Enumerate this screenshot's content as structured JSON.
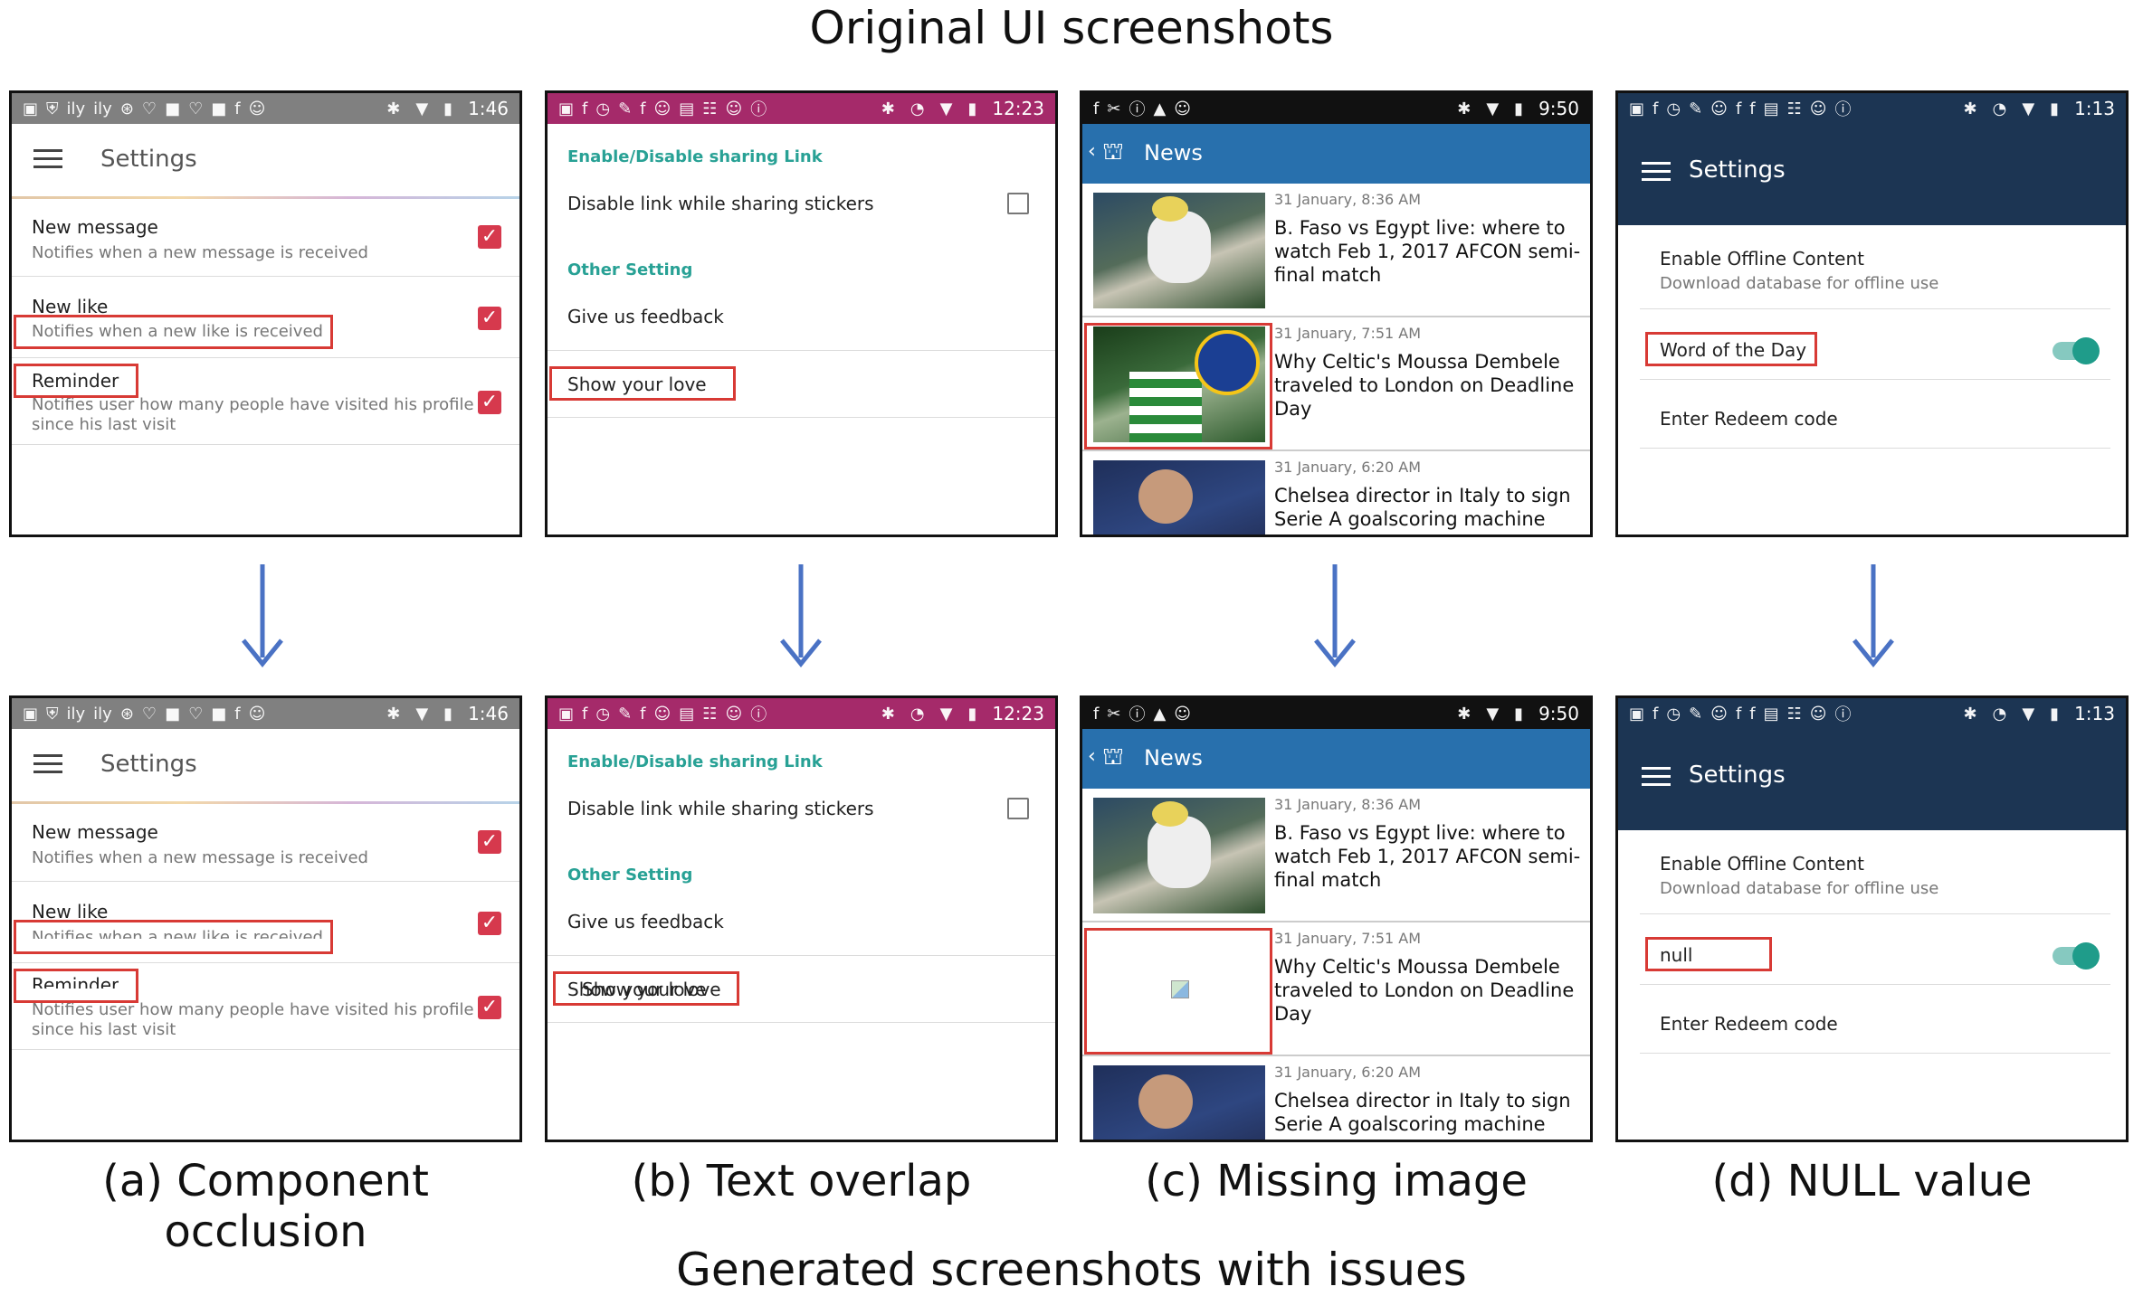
{
  "top_heading": "Original UI screenshots",
  "bottom_heading": "Generated screenshots with issues",
  "captions": [
    "(a) Component occlusion",
    "(b) Text overlap",
    "(c) Missing image",
    "(d) NULL value"
  ],
  "colors": {
    "highlight": "#d83a35",
    "arrow": "#4a72c4",
    "pink_bar": "#a52a6a",
    "news_bar": "#2870ad",
    "navy_bar": "#1c3553",
    "checkbox": "#d6394d",
    "teal": "#28a195"
  },
  "a": {
    "time": "1:46",
    "status_icons": [
      "message-icon",
      "shield-icon",
      "wifi-icon",
      "wifi-icon",
      "download-icon",
      "location-icon",
      "square-icon",
      "location-icon",
      "square-icon",
      "facebook-icon",
      "robot-icon"
    ],
    "title": "Settings",
    "rows": [
      {
        "title": "New message",
        "subtitle": "Notifies when a new message is received"
      },
      {
        "title": "New like",
        "subtitle": "Notifies when a new like is received"
      },
      {
        "title": "Reminder",
        "subtitle": "Notifies user how many people have visited his profile",
        "subtitle2": "since his last visit"
      }
    ]
  },
  "b": {
    "time": "12:23",
    "section1": "Enable/Disable sharing Link",
    "row1": "Disable link while sharing stickers",
    "section2": "Other Setting",
    "row2": "Give us feedback",
    "row3": "Show your love",
    "row3_overlap": "Show your love"
  },
  "c": {
    "time": "9:50",
    "title": "News",
    "articles": [
      {
        "date": "31 January, 8:36 AM",
        "title": "B. Faso vs Egypt live: where to watch Feb 1, 2017 AFCON semi-final match"
      },
      {
        "date": "31 January, 7:51 AM",
        "title": "Why Celtic's Moussa Dembele traveled to London on Deadline Day"
      },
      {
        "date": "31 January, 6:20 AM",
        "title": "Chelsea director in Italy to sign Serie A goalscoring machine"
      }
    ]
  },
  "d": {
    "time": "1:13",
    "title": "Settings",
    "row1_title": "Enable Offline Content",
    "row1_sub": "Download database for offline use",
    "row2": "Word of the Day",
    "row2_null": "null",
    "row3": "Enter Redeem code"
  }
}
